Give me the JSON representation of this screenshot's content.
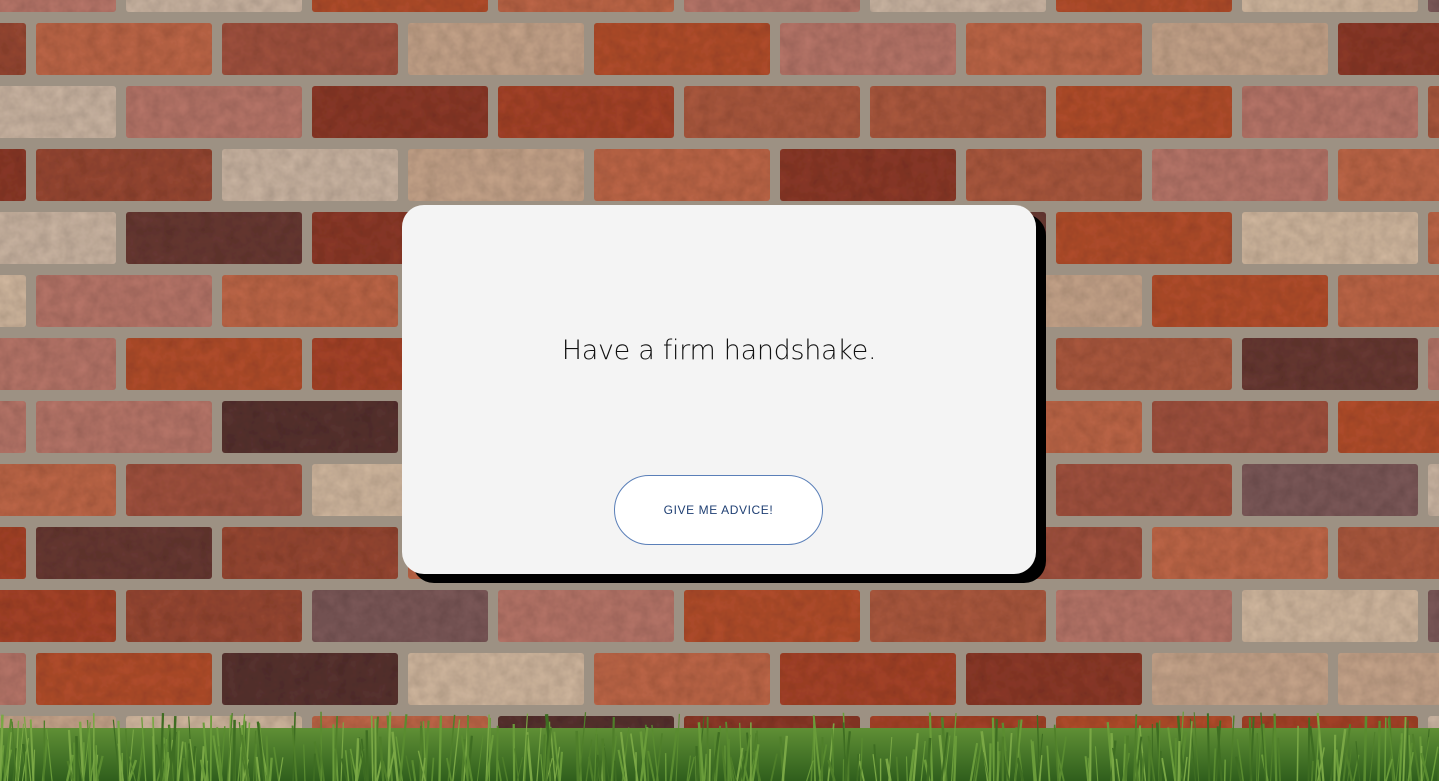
{
  "background": {
    "brick_wall": "brick-wall-image",
    "grass": "grass-image"
  },
  "card": {
    "advice_text": "Have a firm handshake.",
    "button_label": "GIVE ME ADVICE!"
  },
  "colors": {
    "card_bg": "#f4f4f4",
    "card_shadow": "#000000",
    "button_border": "#5a7fb8",
    "button_text": "#1f3f73"
  }
}
